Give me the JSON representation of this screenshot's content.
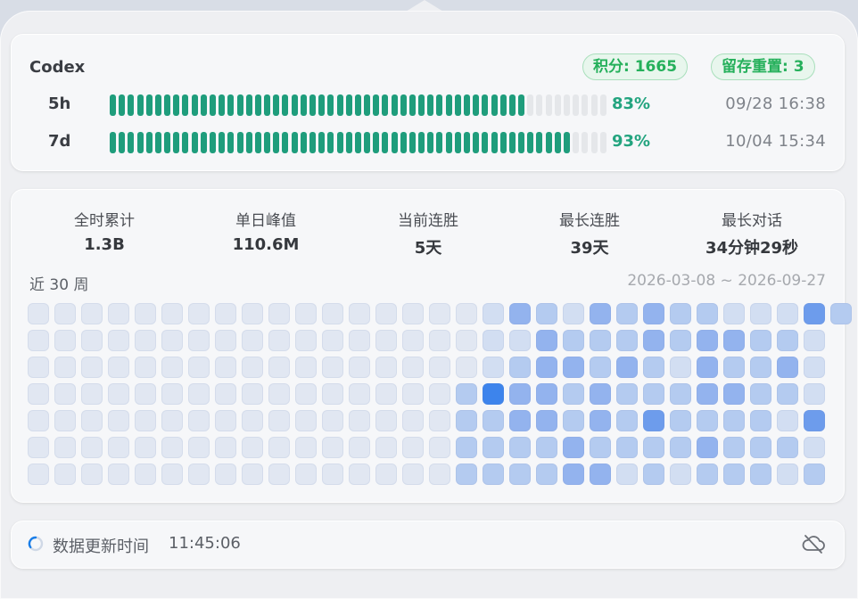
{
  "app": {
    "title": "Codex",
    "points_label": "积分: 1665",
    "resets_label": "留存重置: 3"
  },
  "usage": [
    {
      "label": "5h",
      "percent": 83,
      "percent_text": "83%",
      "reset_at": "09/28 16:38"
    },
    {
      "label": "7d",
      "percent": 93,
      "percent_text": "93%",
      "reset_at": "10/04 15:34"
    }
  ],
  "stats": [
    {
      "label": "全时累计",
      "value": "1.3B"
    },
    {
      "label": "单日峰值",
      "value": "110.6M"
    },
    {
      "label": "当前连胜",
      "value": "5天"
    },
    {
      "label": "最长连胜",
      "value": "39天"
    },
    {
      "label": "最长对话",
      "value": "34分钟29秒"
    }
  ],
  "heatmap": {
    "title": "近 30 周",
    "range": "2026-03-08 ~ 2026-09-27",
    "levels": [
      [
        0,
        0,
        0,
        0,
        0,
        0,
        0,
        0,
        0,
        0,
        0,
        0,
        0,
        0,
        0,
        0,
        0,
        1,
        3,
        2,
        1,
        3,
        2,
        3,
        2,
        2,
        1,
        1,
        1,
        4,
        2
      ],
      [
        0,
        0,
        0,
        0,
        0,
        0,
        0,
        0,
        0,
        0,
        0,
        0,
        0,
        0,
        0,
        0,
        0,
        1,
        1,
        3,
        2,
        2,
        2,
        3,
        2,
        3,
        3,
        2,
        2,
        1,
        null
      ],
      [
        0,
        0,
        0,
        0,
        0,
        0,
        0,
        0,
        0,
        0,
        0,
        0,
        0,
        0,
        0,
        0,
        0,
        1,
        2,
        3,
        3,
        2,
        3,
        2,
        1,
        3,
        2,
        2,
        3,
        1,
        null
      ],
      [
        0,
        0,
        0,
        0,
        0,
        0,
        0,
        0,
        0,
        0,
        0,
        0,
        0,
        0,
        0,
        0,
        2,
        5,
        3,
        3,
        2,
        3,
        2,
        2,
        2,
        3,
        3,
        2,
        2,
        1,
        null
      ],
      [
        0,
        0,
        0,
        0,
        0,
        0,
        0,
        0,
        0,
        0,
        0,
        0,
        0,
        0,
        0,
        0,
        2,
        2,
        3,
        3,
        2,
        3,
        2,
        4,
        2,
        2,
        2,
        2,
        1,
        4,
        null
      ],
      [
        0,
        0,
        0,
        0,
        0,
        0,
        0,
        0,
        0,
        0,
        0,
        0,
        0,
        0,
        0,
        0,
        2,
        2,
        2,
        2,
        3,
        2,
        2,
        2,
        2,
        3,
        2,
        2,
        2,
        1,
        null
      ],
      [
        0,
        0,
        0,
        0,
        0,
        0,
        0,
        0,
        0,
        0,
        0,
        0,
        0,
        0,
        0,
        0,
        2,
        2,
        2,
        2,
        3,
        3,
        1,
        2,
        1,
        2,
        2,
        2,
        1,
        2,
        null
      ]
    ],
    "colors": [
      "#e1e7f2",
      "#d2def2",
      "#b4cbf0",
      "#93b3ee",
      "#6d9cec",
      "#3d84ec"
    ]
  },
  "footer": {
    "label": "数据更新时间",
    "time": "11:45:06"
  },
  "theme": {
    "bar_fill": "#1f9d7c",
    "bar_empty": "#e5e7ea",
    "accent_green": "#25b05b",
    "spinner": "#1a7ee8"
  }
}
